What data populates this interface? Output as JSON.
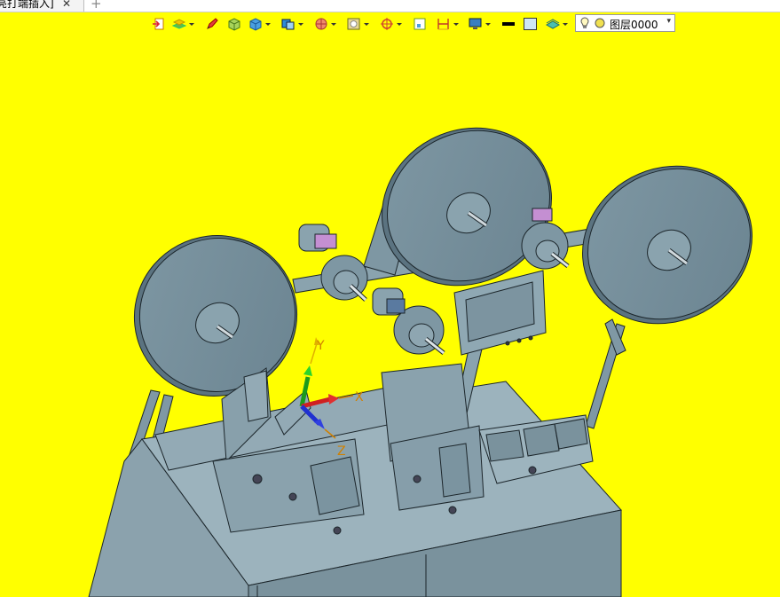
{
  "tab": {
    "title": "亮打端插入]",
    "close_glyph": "✕",
    "add_glyph": "+"
  },
  "toolbar": {
    "icons": [
      "exit-icon",
      "layer-stack-icon",
      "pencil-icon",
      "box-face-icon",
      "cube-icon",
      "view-orientation-icon",
      "sphere-render-icon",
      "display-style-icon",
      "snap-target-icon",
      "frame-select-icon",
      "measure-icon",
      "monitor-icon",
      "line-color-swatch",
      "fill-color-swatch",
      "layer-visibility-icon"
    ],
    "line_color": "#000000",
    "fill_color": "#cfe6f5"
  },
  "layer_selector": {
    "value": "图层0000",
    "dropdown_glyph": "▾"
  },
  "viewport": {
    "background": "#ffff00",
    "axes": {
      "y_label": "Y",
      "x_label": "X",
      "z_label": "Z"
    }
  }
}
